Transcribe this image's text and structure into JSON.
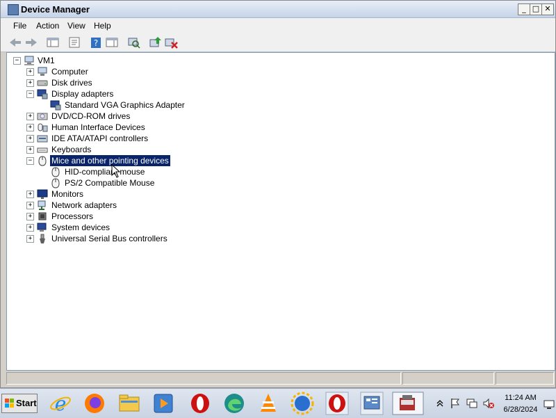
{
  "window": {
    "title": "Device Manager",
    "controls": {
      "minimize": "_",
      "maximize": "□",
      "close": "✕"
    }
  },
  "menu": [
    "File",
    "Action",
    "View",
    "Help"
  ],
  "toolbar": {
    "icons": [
      "back-icon",
      "forward-icon",
      "console-tree-icon",
      "properties-icon",
      "help-icon",
      "action-pane-icon",
      "scan-hardware-icon",
      "update-driver-icon",
      "uninstall-icon"
    ]
  },
  "tree": {
    "root": "VM1",
    "nodes": [
      {
        "label": "Computer",
        "expander": "+",
        "level": 1,
        "icon": "computer-icon"
      },
      {
        "label": "Disk drives",
        "expander": "+",
        "level": 1,
        "icon": "disk-icon"
      },
      {
        "label": "Display adapters",
        "expander": "−",
        "level": 1,
        "icon": "display-icon"
      },
      {
        "label": "Standard VGA Graphics Adapter",
        "expander": "",
        "level": 2,
        "icon": "display-icon"
      },
      {
        "label": "DVD/CD-ROM drives",
        "expander": "+",
        "level": 1,
        "icon": "dvd-icon"
      },
      {
        "label": "Human Interface Devices",
        "expander": "+",
        "level": 1,
        "icon": "hid-icon"
      },
      {
        "label": "IDE ATA/ATAPI controllers",
        "expander": "+",
        "level": 1,
        "icon": "ide-icon"
      },
      {
        "label": "Keyboards",
        "expander": "+",
        "level": 1,
        "icon": "keyboard-icon"
      },
      {
        "label": "Mice and other pointing devices",
        "expander": "−",
        "level": 1,
        "icon": "mouse-icon",
        "selected": true
      },
      {
        "label": "HID-compliant mouse",
        "expander": "",
        "level": 2,
        "icon": "mouse-icon"
      },
      {
        "label": "PS/2 Compatible Mouse",
        "expander": "",
        "level": 2,
        "icon": "mouse-icon"
      },
      {
        "label": "Monitors",
        "expander": "+",
        "level": 1,
        "icon": "monitor-icon"
      },
      {
        "label": "Network adapters",
        "expander": "+",
        "level": 1,
        "icon": "network-icon"
      },
      {
        "label": "Processors",
        "expander": "+",
        "level": 1,
        "icon": "processor-icon"
      },
      {
        "label": "System devices",
        "expander": "+",
        "level": 1,
        "icon": "system-icon"
      },
      {
        "label": "Universal Serial Bus controllers",
        "expander": "+",
        "level": 1,
        "icon": "usb-icon"
      }
    ]
  },
  "taskbar": {
    "start_label": "Start",
    "apps": [
      "ie-icon",
      "firefox-icon",
      "file-explorer-icon",
      "media-player-icon",
      "opera-icon",
      "edge-icon",
      "vlc-icon",
      "globe-icon",
      "opera-icon",
      "server-manager-icon",
      "device-manager-icon"
    ],
    "clock_time": "11:24 AM",
    "clock_date": "6/28/2024"
  },
  "colors": {
    "selection": "#0a246a",
    "tree_bg": "#ffffff",
    "chrome": "#f0f0f0"
  }
}
